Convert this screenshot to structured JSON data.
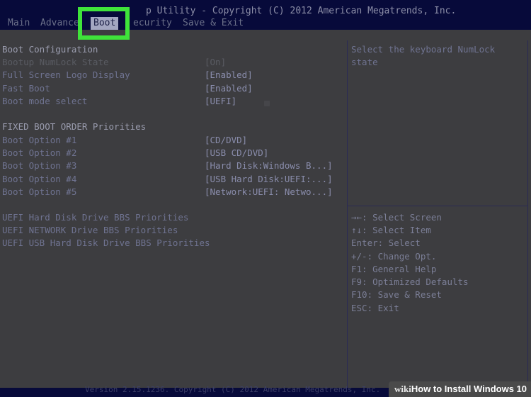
{
  "header": {
    "title": "p Utility - Copyright (C) 2012 American Megatrends, Inc.",
    "tabs": [
      {
        "label": "Main"
      },
      {
        "label": "Advance"
      },
      {
        "label": "Boot",
        "active": true
      },
      {
        "label": "ecurity"
      },
      {
        "label": "Save & Exit"
      }
    ]
  },
  "settings": {
    "section_title": "Boot Configuration",
    "numlock": {
      "label": "Bootup NumLock State",
      "value": "[On]"
    },
    "logo": {
      "label": "Full Screen Logo Display",
      "value": "[Enabled]"
    },
    "fastboot": {
      "label": "Fast Boot",
      "value": "[Enabled]"
    },
    "bootmode": {
      "label": "Boot mode select",
      "value": "[UEFI]"
    },
    "priorities_title": "FIXED BOOT ORDER Priorities",
    "options": [
      {
        "label": "Boot Option #1",
        "value": "[CD/DVD]"
      },
      {
        "label": "Boot Option #2",
        "value": "[USB CD/DVD]"
      },
      {
        "label": "Boot Option #3",
        "value": "[Hard Disk:Windows B...]"
      },
      {
        "label": "Boot Option #4",
        "value": "[USB Hard Disk:UEFI:...]"
      },
      {
        "label": "Boot Option #5",
        "value": "[Network:UEFI: Netwo...]"
      }
    ],
    "links": [
      {
        "label": "UEFI Hard Disk Drive BBS Priorities"
      },
      {
        "label": "UEFI NETWORK Drive BBS Priorities"
      },
      {
        "label": "UEFI USB Hard Disk Drive BBS Priorities"
      }
    ]
  },
  "help": {
    "line1": "Select the keyboard NumLock",
    "line2": "state"
  },
  "keys": [
    "→←: Select Screen",
    "↑↓: Select Item",
    "Enter: Select",
    "+/-: Change Opt.",
    "F1: General Help",
    "F9: Optimized Defaults",
    "F10: Save & Reset",
    "ESC: Exit"
  ],
  "footer": {
    "text": "Version 2.15.1236. Copyright (C) 2012 American Megatrends, Inc."
  },
  "watermark": {
    "brand": "wiki",
    "text": "How to Install Windows 10"
  },
  "colors": {
    "highlight": "#3fe33a",
    "bar": "#070a3a",
    "panel": "#3d3d40"
  }
}
